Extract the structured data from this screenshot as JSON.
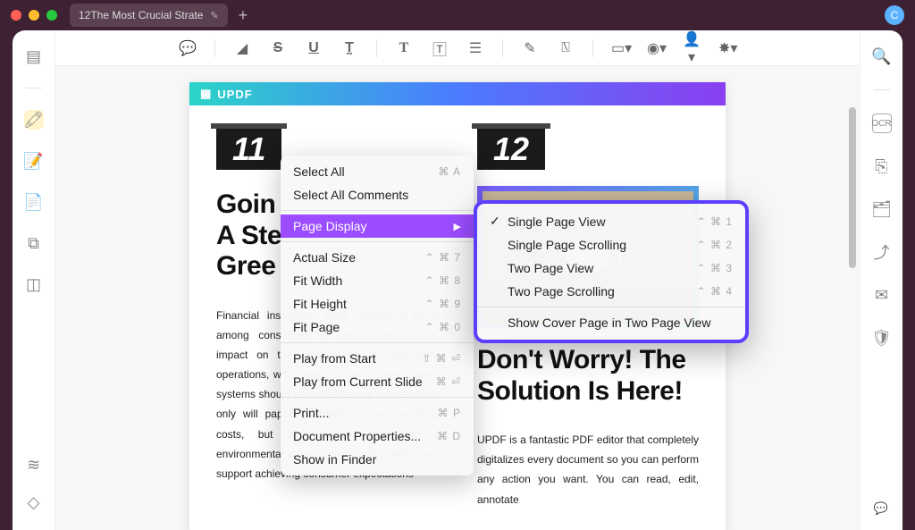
{
  "titlebar": {
    "tab_title": "12The Most Crucial Strate",
    "avatar_letter": "C"
  },
  "left_rail": {
    "items": [
      "reader-icon",
      "highlighter-icon",
      "edit-icon",
      "page-icon",
      "crop-icon",
      "compare-icon"
    ],
    "bottom": [
      "layers-icon",
      "bookmark-icon"
    ]
  },
  "right_rail": {
    "items": [
      "search-icon",
      "ocr-icon",
      "export-icon",
      "organize-icon",
      "share-icon",
      "mail-icon",
      "protect-icon"
    ],
    "bottom": "comment-icon"
  },
  "toolbar": {
    "items": [
      "comment-tool",
      "|",
      "highlight-tool",
      "strike-tool",
      "underline-tool",
      "squiggly-tool",
      "|",
      "text-tool",
      "textbox-tool",
      "callout-tool",
      "|",
      "pen-tool",
      "eraser-tool",
      "|",
      "shape-tool",
      "stamp-tool",
      "signature-tool",
      "sticker-tool"
    ]
  },
  "document": {
    "brand": "UPDF",
    "col1": {
      "num": "11",
      "title_l1": "Goin",
      "title_l2": "A Ste",
      "title_l3": "Gree",
      "para": "Financial institutions have noticed a trend among consumers in which their carbon impact on the environment in their daily operations, with paperless being paper-based systems should become their top concern. Not only will paperless banking save operating costs, but it will also contribute to environmental preservation. Additionally, it will support achieving consumer expectations"
    },
    "col2": {
      "num": "12",
      "title_l1": "Don't Worry! The",
      "title_l2": "Solution Is Here!",
      "para": "UPDF is a fantastic PDF editor that completely digitalizes every document so you can perform any action you want. You can read, edit, annotate"
    }
  },
  "ctxmenu": {
    "items": [
      {
        "label": "Select All",
        "shortcut": "⌘ A"
      },
      {
        "label": "Select All Comments",
        "shortcut": ""
      },
      {
        "sep": true
      },
      {
        "label": "Page Display",
        "shortcut": "",
        "hl": true,
        "sub": true
      },
      {
        "sep": true
      },
      {
        "label": "Actual Size",
        "shortcut": "⌃ ⌘ 7"
      },
      {
        "label": "Fit Width",
        "shortcut": "⌃ ⌘ 8"
      },
      {
        "label": "Fit Height",
        "shortcut": "⌃ ⌘ 9"
      },
      {
        "label": "Fit Page",
        "shortcut": "⌃ ⌘ 0"
      },
      {
        "sep": true
      },
      {
        "label": "Play from Start",
        "shortcut": "⇧ ⌘ ⏎"
      },
      {
        "label": "Play from Current Slide",
        "shortcut": "⌘ ⏎"
      },
      {
        "sep": true
      },
      {
        "label": "Print...",
        "shortcut": "⌘ P"
      },
      {
        "label": "Document Properties...",
        "shortcut": "⌘ D"
      },
      {
        "label": "Show in Finder",
        "shortcut": ""
      }
    ]
  },
  "submenu": {
    "items": [
      {
        "label": "Single Page View",
        "shortcut": "⌃ ⌘ 1",
        "checked": true
      },
      {
        "label": "Single Page Scrolling",
        "shortcut": "⌃ ⌘ 2"
      },
      {
        "label": "Two Page View",
        "shortcut": "⌃ ⌘ 3"
      },
      {
        "label": "Two Page Scrolling",
        "shortcut": "⌃ ⌘ 4"
      },
      {
        "sep": true
      },
      {
        "label": "Show Cover Page in Two Page View",
        "shortcut": ""
      }
    ]
  }
}
